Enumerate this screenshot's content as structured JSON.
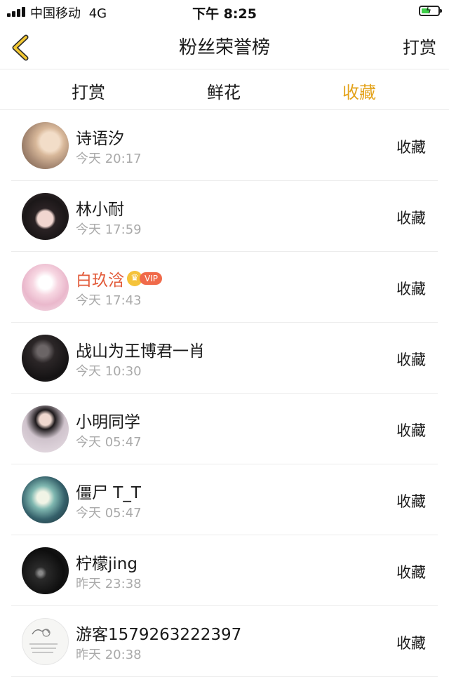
{
  "status_bar": {
    "carrier": "中国移动",
    "network": "4G",
    "time": "下午 8:25"
  },
  "nav": {
    "back_icon": "chevron-left-icon",
    "title": "粉丝荣誉榜",
    "right_label": "打赏"
  },
  "tabs": [
    {
      "label": "打赏",
      "active": false
    },
    {
      "label": "鲜花",
      "active": false
    },
    {
      "label": "收藏",
      "active": true
    }
  ],
  "colors": {
    "accent": "#e3a21a",
    "highlight_name": "#e25b3a",
    "secondary_text": "#a9a9a9",
    "divider": "#ececec"
  },
  "fans": [
    {
      "name": "诗语汐",
      "time": "今天 20:17",
      "action": "收藏"
    },
    {
      "name": "林小耐",
      "time": "今天 17:59",
      "action": "收藏"
    },
    {
      "name": "白玖浛",
      "time": "今天 17:43",
      "action": "收藏",
      "vip": "VIP",
      "highlight": true
    },
    {
      "name": "战山为王博君一肖",
      "time": "今天 10:30",
      "action": "收藏"
    },
    {
      "name": "小明同学",
      "time": "今天 05:47",
      "action": "收藏"
    },
    {
      "name": "僵尸 T_T",
      "time": "今天 05:47",
      "action": "收藏"
    },
    {
      "name": "柠檬jing",
      "time": "昨天 23:38",
      "action": "收藏"
    },
    {
      "name": "游客1579263222397",
      "time": "昨天 20:38",
      "action": "收藏"
    }
  ]
}
